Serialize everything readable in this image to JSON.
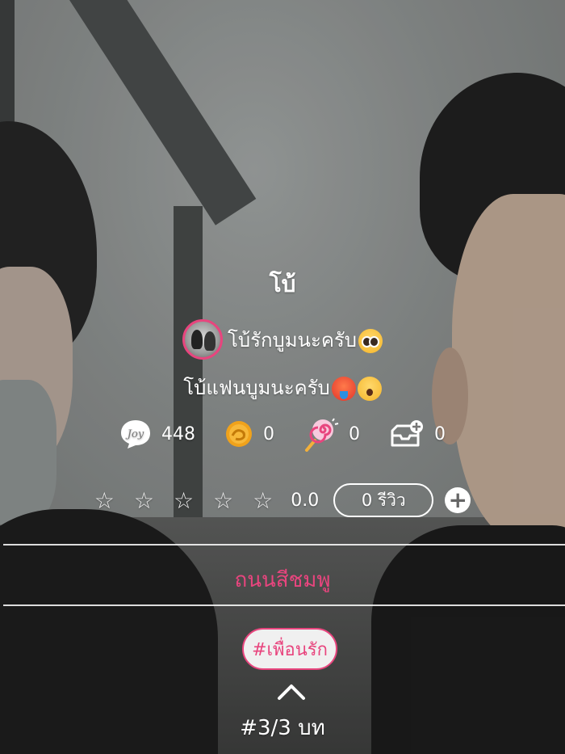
{
  "profile": {
    "name": "โบ้",
    "status": "โบ้รักบูมนะครับ",
    "bio": "โบ้แฟนบูมนะครับ"
  },
  "stats": {
    "joy_count": "448",
    "coin_count": "0",
    "candy_count": "0",
    "inbox_count": "0"
  },
  "rating": {
    "stars_filled": 0,
    "stars_total": 5,
    "value": "0.0",
    "review_button_label": "0 รีวิว",
    "add_icon": "plus-circle-icon"
  },
  "place": {
    "name": "ถนนสีชมพู"
  },
  "hashtag": {
    "label": "#เพื่อนรัก"
  },
  "pager": {
    "label": "#3/3 บท"
  },
  "colors": {
    "accent": "#e8457e",
    "text": "#ffffff"
  },
  "icons": [
    "joy-icon",
    "coin-icon",
    "lollipop-icon",
    "inbox-icon",
    "star-outline-icon",
    "chevron-up-icon"
  ]
}
